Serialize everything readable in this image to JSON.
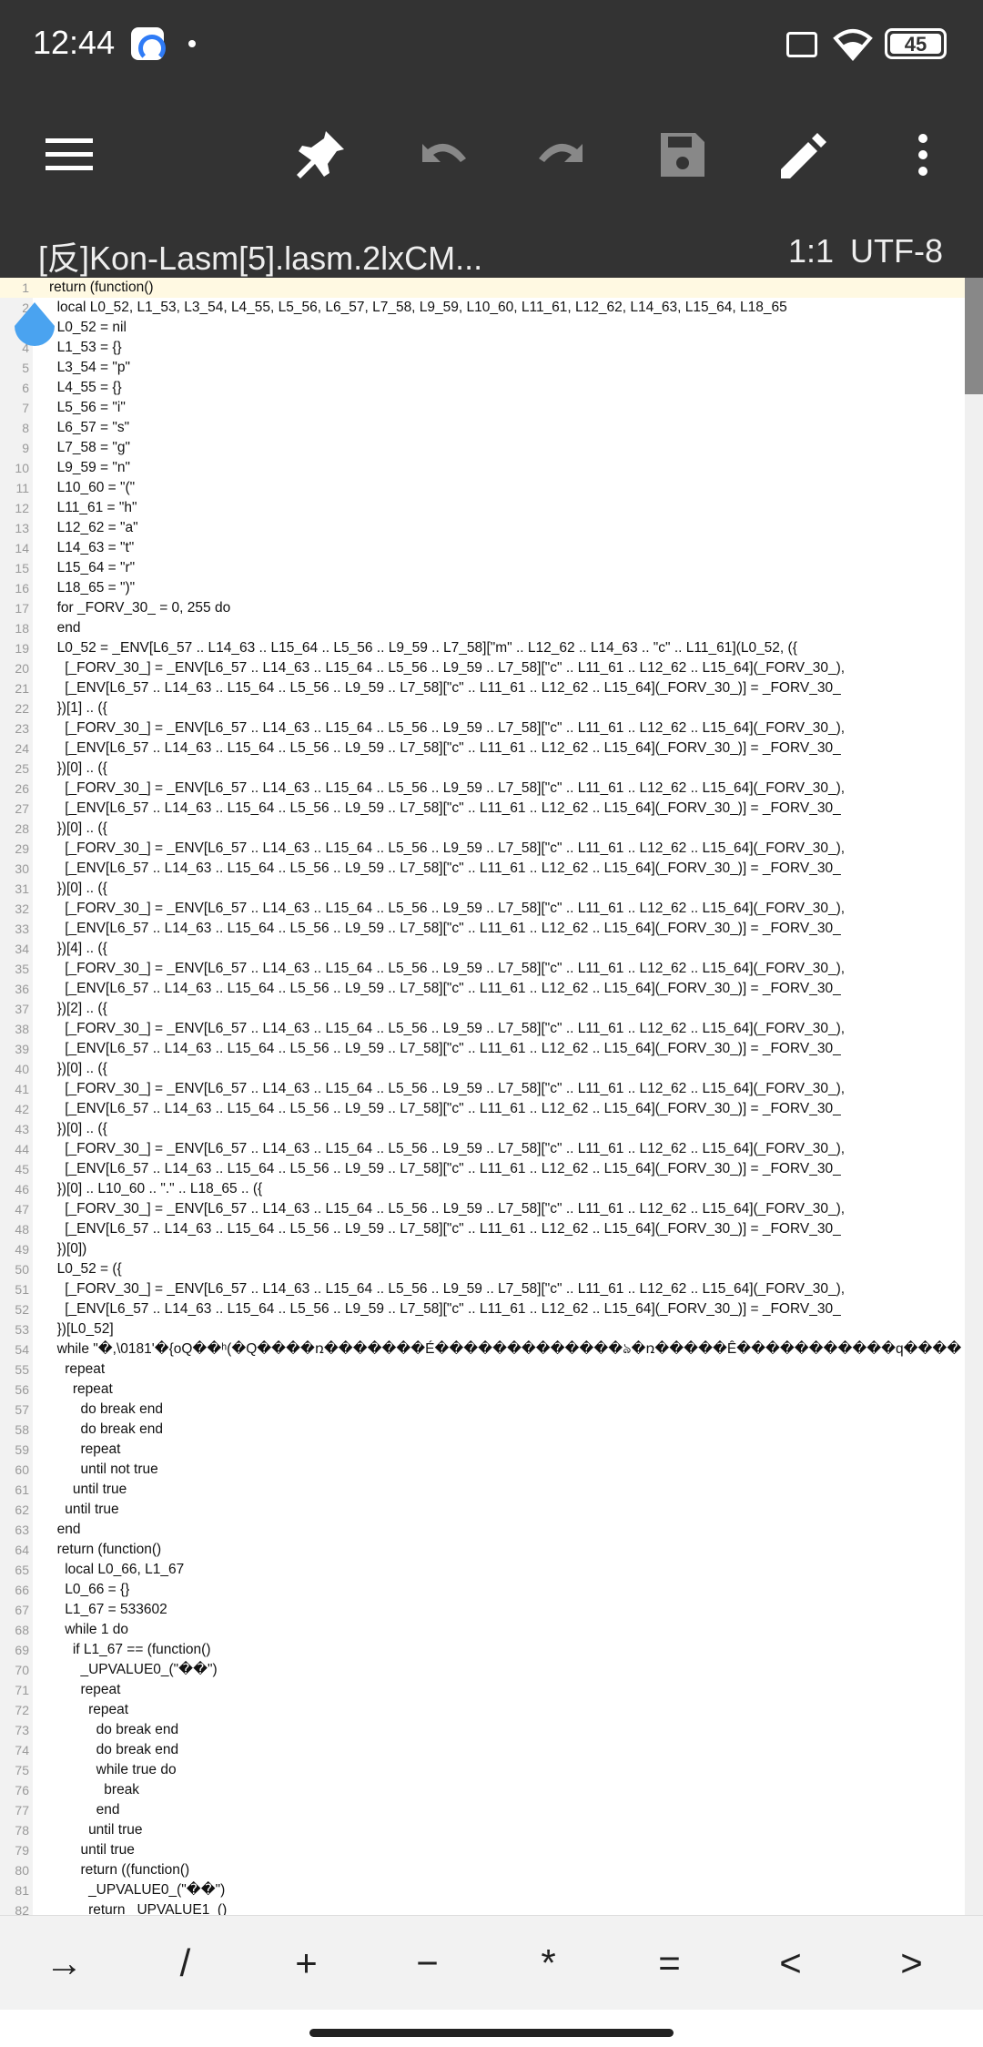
{
  "status": {
    "time": "12:44",
    "battery": "45"
  },
  "toolbar": {
    "menu_icon": "hamburger-menu-icon",
    "pin_icon": "pin-icon",
    "undo_icon": "undo-icon",
    "redo_icon": "redo-icon",
    "save_icon": "save-icon",
    "edit_icon": "pencil-icon",
    "more_icon": "more-vert-icon"
  },
  "title_bar": {
    "file_name": "[反]Kon-Lasm[5].lasm.2lxCM...",
    "cursor_pos": "1:1",
    "encoding": "UTF-8"
  },
  "editor": {
    "lines": [
      "return (function()",
      "  local L0_52, L1_53, L3_54, L4_55, L5_56, L6_57, L7_58, L9_59, L10_60, L11_61, L12_62, L14_63, L15_64, L18_65",
      "  L0_52 = nil",
      "  L1_53 = {}",
      "  L3_54 = \"p\"",
      "  L4_55 = {}",
      "  L5_56 = \"i\"",
      "  L6_57 = \"s\"",
      "  L7_58 = \"g\"",
      "  L9_59 = \"n\"",
      "  L10_60 = \"(\"",
      "  L11_61 = \"h\"",
      "  L12_62 = \"a\"",
      "  L14_63 = \"t\"",
      "  L15_64 = \"r\"",
      "  L18_65 = \")\"",
      "  for _FORV_30_ = 0, 255 do",
      "  end",
      "  L0_52 = _ENV[L6_57 .. L14_63 .. L15_64 .. L5_56 .. L9_59 .. L7_58][\"m\" .. L12_62 .. L14_63 .. \"c\" .. L11_61](L0_52, ({",
      "    [_FORV_30_] = _ENV[L6_57 .. L14_63 .. L15_64 .. L5_56 .. L9_59 .. L7_58][\"c\" .. L11_61 .. L12_62 .. L15_64](_FORV_30_),",
      "    [_ENV[L6_57 .. L14_63 .. L15_64 .. L5_56 .. L9_59 .. L7_58][\"c\" .. L11_61 .. L12_62 .. L15_64](_FORV_30_)] = _FORV_30_",
      "  })[1] .. ({",
      "    [_FORV_30_] = _ENV[L6_57 .. L14_63 .. L15_64 .. L5_56 .. L9_59 .. L7_58][\"c\" .. L11_61 .. L12_62 .. L15_64](_FORV_30_),",
      "    [_ENV[L6_57 .. L14_63 .. L15_64 .. L5_56 .. L9_59 .. L7_58][\"c\" .. L11_61 .. L12_62 .. L15_64](_FORV_30_)] = _FORV_30_",
      "  })[0] .. ({",
      "    [_FORV_30_] = _ENV[L6_57 .. L14_63 .. L15_64 .. L5_56 .. L9_59 .. L7_58][\"c\" .. L11_61 .. L12_62 .. L15_64](_FORV_30_),",
      "    [_ENV[L6_57 .. L14_63 .. L15_64 .. L5_56 .. L9_59 .. L7_58][\"c\" .. L11_61 .. L12_62 .. L15_64](_FORV_30_)] = _FORV_30_",
      "  })[0] .. ({",
      "    [_FORV_30_] = _ENV[L6_57 .. L14_63 .. L15_64 .. L5_56 .. L9_59 .. L7_58][\"c\" .. L11_61 .. L12_62 .. L15_64](_FORV_30_),",
      "    [_ENV[L6_57 .. L14_63 .. L15_64 .. L5_56 .. L9_59 .. L7_58][\"c\" .. L11_61 .. L12_62 .. L15_64](_FORV_30_)] = _FORV_30_",
      "  })[0] .. ({",
      "    [_FORV_30_] = _ENV[L6_57 .. L14_63 .. L15_64 .. L5_56 .. L9_59 .. L7_58][\"c\" .. L11_61 .. L12_62 .. L15_64](_FORV_30_),",
      "    [_ENV[L6_57 .. L14_63 .. L15_64 .. L5_56 .. L9_59 .. L7_58][\"c\" .. L11_61 .. L12_62 .. L15_64](_FORV_30_)] = _FORV_30_",
      "  })[4] .. ({",
      "    [_FORV_30_] = _ENV[L6_57 .. L14_63 .. L15_64 .. L5_56 .. L9_59 .. L7_58][\"c\" .. L11_61 .. L12_62 .. L15_64](_FORV_30_),",
      "    [_ENV[L6_57 .. L14_63 .. L15_64 .. L5_56 .. L9_59 .. L7_58][\"c\" .. L11_61 .. L12_62 .. L15_64](_FORV_30_)] = _FORV_30_",
      "  })[2] .. ({",
      "    [_FORV_30_] = _ENV[L6_57 .. L14_63 .. L15_64 .. L5_56 .. L9_59 .. L7_58][\"c\" .. L11_61 .. L12_62 .. L15_64](_FORV_30_),",
      "    [_ENV[L6_57 .. L14_63 .. L15_64 .. L5_56 .. L9_59 .. L7_58][\"c\" .. L11_61 .. L12_62 .. L15_64](_FORV_30_)] = _FORV_30_",
      "  })[0] .. ({",
      "    [_FORV_30_] = _ENV[L6_57 .. L14_63 .. L15_64 .. L5_56 .. L9_59 .. L7_58][\"c\" .. L11_61 .. L12_62 .. L15_64](_FORV_30_),",
      "    [_ENV[L6_57 .. L14_63 .. L15_64 .. L5_56 .. L9_59 .. L7_58][\"c\" .. L11_61 .. L12_62 .. L15_64](_FORV_30_)] = _FORV_30_",
      "  })[0] .. ({",
      "    [_FORV_30_] = _ENV[L6_57 .. L14_63 .. L15_64 .. L5_56 .. L9_59 .. L7_58][\"c\" .. L11_61 .. L12_62 .. L15_64](_FORV_30_),",
      "    [_ENV[L6_57 .. L14_63 .. L15_64 .. L5_56 .. L9_59 .. L7_58][\"c\" .. L11_61 .. L12_62 .. L15_64](_FORV_30_)] = _FORV_30_",
      "  })[0] .. L10_60 .. \".\" .. L18_65 .. ({",
      "    [_FORV_30_] = _ENV[L6_57 .. L14_63 .. L15_64 .. L5_56 .. L9_59 .. L7_58][\"c\" .. L11_61 .. L12_62 .. L15_64](_FORV_30_),",
      "    [_ENV[L6_57 .. L14_63 .. L15_64 .. L5_56 .. L9_59 .. L7_58][\"c\" .. L11_61 .. L12_62 .. L15_64](_FORV_30_)] = _FORV_30_",
      "  })[0])",
      "  L0_52 = ({",
      "    [_FORV_30_] = _ENV[L6_57 .. L14_63 .. L15_64 .. L5_56 .. L9_59 .. L7_58][\"c\" .. L11_61 .. L12_62 .. L15_64](_FORV_30_),",
      "    [_ENV[L6_57 .. L14_63 .. L15_64 .. L5_56 .. L9_59 .. L7_58][\"c\" .. L11_61 .. L12_62 .. L15_64](_FORV_30_)] = _FORV_30_",
      "  })[L0_52]",
      "  while \"�,\\0181'�{oQ��ʰ(�Q����ռ�������É�������������ঌ�ռ�����Ê�����������q����",
      "    repeat",
      "      repeat",
      "        do break end",
      "        do break end",
      "        repeat",
      "        until not true",
      "      until true",
      "    until true",
      "  end",
      "  return (function()",
      "    local L0_66, L1_67",
      "    L0_66 = {}",
      "    L1_67 = 533602",
      "    while 1 do",
      "      if L1_67 == (function()",
      "        _UPVALUE0_(\"��\")",
      "        repeat",
      "          repeat",
      "            do break end",
      "            do break end",
      "            while true do",
      "              break",
      "            end",
      "          until true",
      "        until true",
      "        return ((function()",
      "          _UPVALUE0_(\"��\")",
      "          return _UPVALUE1_()"
    ]
  },
  "keys": [
    "→",
    "/",
    "+",
    "−",
    "*",
    "=",
    "<",
    ">"
  ]
}
